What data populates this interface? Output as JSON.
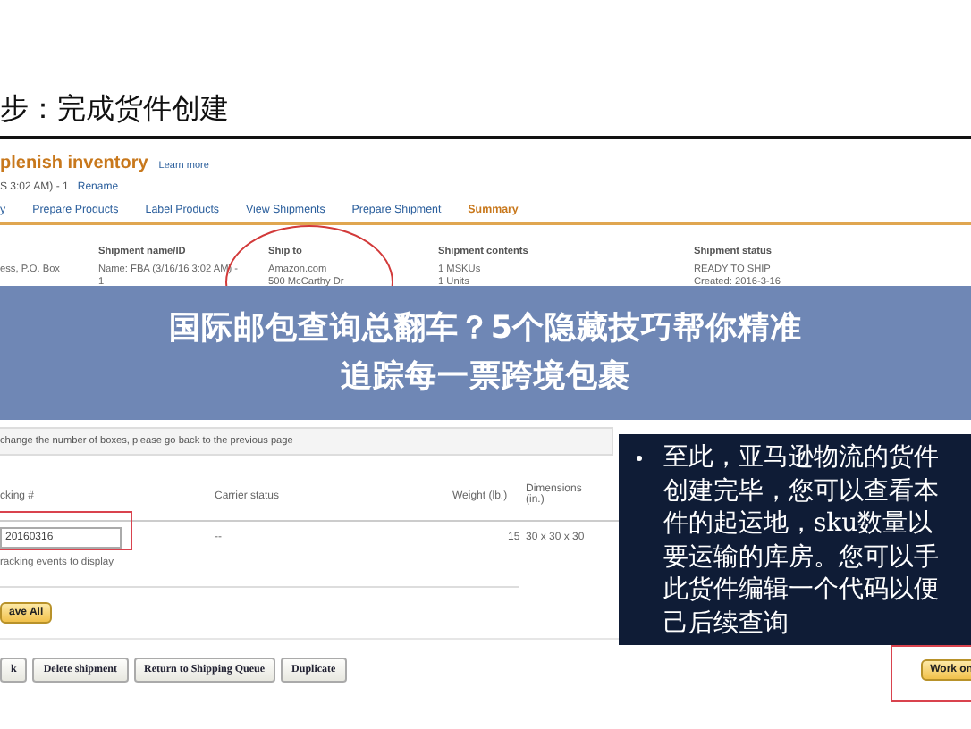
{
  "slide": {
    "heading": "步：完成货件创建"
  },
  "page": {
    "title": "plenish inventory",
    "learn_more": "Learn more",
    "subtitle": "S 3:02 AM) - 1",
    "rename": "Rename",
    "tabs": [
      {
        "label": "y",
        "selected": false
      },
      {
        "label": "Prepare Products",
        "selected": false
      },
      {
        "label": "Label Products",
        "selected": false
      },
      {
        "label": "View Shipments",
        "selected": false
      },
      {
        "label": "Prepare Shipment",
        "selected": false
      },
      {
        "label": "Summary",
        "selected": true
      }
    ],
    "info_columns": [
      {
        "lines": [
          "ess, P.O. Box"
        ]
      },
      {
        "heading": "Shipment name/ID",
        "lines": [
          "Name: FBA (3/16/16 3:02 AM) -",
          "1"
        ]
      },
      {
        "heading": "Ship to",
        "lines": [
          "Amazon.com",
          "500 McCarthy Dr"
        ]
      },
      {
        "heading": "Shipment contents",
        "lines": [
          "1 MSKUs",
          "1 Units"
        ]
      },
      {
        "heading": "Shipment status",
        "lines": [
          "READY TO SHIP",
          "Created: 2016-3-16"
        ]
      }
    ],
    "notice": "change the number of boxes, please go back to the previous page",
    "table": {
      "columns": [
        "cking #",
        "Carrier status",
        "Weight (lb.)",
        "Dimensions (in.)"
      ],
      "rows": [
        {
          "tracking": "20160316",
          "carrier_status": "--",
          "weight": "15",
          "dimensions": "30 x 30 x 30",
          "events": "racking events to display"
        }
      ]
    },
    "save_button": "ave All",
    "action_buttons": [
      "k",
      "Delete shipment",
      "Return to Shipping Queue",
      "Duplicate"
    ],
    "work_on_button": "Work on"
  },
  "callouts": [
    {
      "bullet": true,
      "lines": [
        "至此，亚马逊物流的货件",
        "创建完毕，您可以查看本",
        "件的起运地，sku数量以",
        "要运输的库房。您可以手",
        "此货件编辑一个代码以便",
        "己后续查询"
      ]
    }
  ],
  "banner": {
    "title": "国际邮包查询总翻车？5个隐藏技巧帮你精准追踪每一票跨境包裹"
  }
}
